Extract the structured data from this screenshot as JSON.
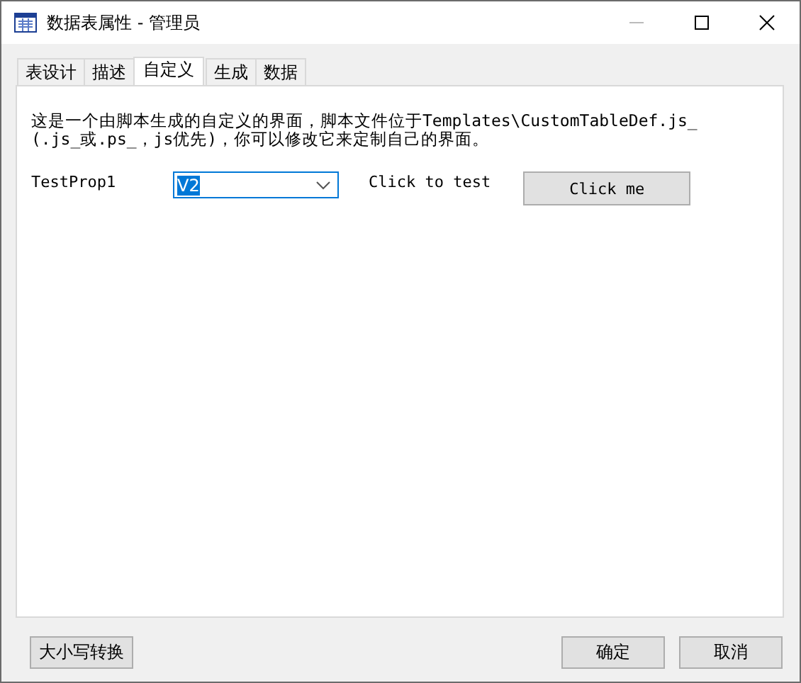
{
  "window": {
    "title": "数据表属性 - 管理员"
  },
  "tabs": [
    {
      "label": "表设计",
      "selected": false
    },
    {
      "label": "描述",
      "selected": false
    },
    {
      "label": "自定义",
      "selected": true
    },
    {
      "label": "生成",
      "selected": false
    },
    {
      "label": "数据",
      "selected": false
    }
  ],
  "description_lines": [
    "这是一个由脚本生成的自定义的界面，脚本文件位于Templates\\CustomTableDef.js_",
    "(.js_或.ps_，js优先)，你可以修改它来定制自己的界面。"
  ],
  "property": {
    "label": "TestProp1",
    "value": "V2",
    "value_highlighted": true
  },
  "test_label": "Click to test",
  "test_button": "Click me",
  "footer_left_buttons": [
    "大小写转换"
  ],
  "footer_right_buttons": [
    "确定",
    "取消"
  ]
}
